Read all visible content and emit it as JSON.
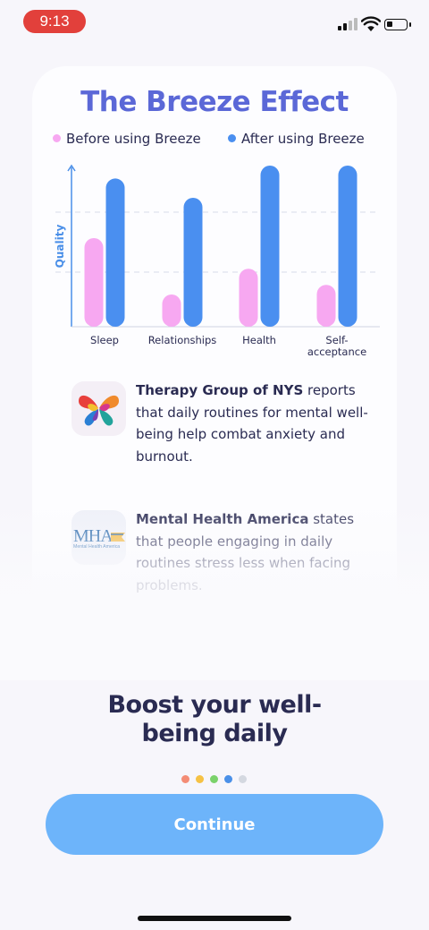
{
  "status_bar": {
    "time": "9:13"
  },
  "card": {
    "title": "The Breeze Effect",
    "legend": {
      "before": "Before using Breeze",
      "after": "After using Breeze"
    }
  },
  "chart_data": {
    "type": "bar",
    "title": "The Breeze Effect",
    "ylabel": "Quality",
    "categories": [
      "Sleep",
      "Relationships",
      "Health",
      "Self-acceptance"
    ],
    "category_lines": [
      [
        "Sleep"
      ],
      [
        "Relationships"
      ],
      [
        "Health"
      ],
      [
        "Self-",
        "acceptance"
      ]
    ],
    "series": [
      {
        "name": "Before using Breeze",
        "color": "#f7a8f1",
        "values": [
          0.55,
          0.2,
          0.36,
          0.26
        ]
      },
      {
        "name": "After using Breeze",
        "color": "#4a8ff0",
        "values": [
          0.92,
          0.8,
          1.0,
          1.0
        ]
      }
    ],
    "ylim": [
      0,
      1
    ],
    "grid": true,
    "legend_position": "top"
  },
  "sources": [
    {
      "org": "Therapy Group of NYS",
      "text": " reports that daily routines for mental well-being help combat anxiety and burnout.",
      "icon": "butterfly-logo-icon"
    },
    {
      "org": "Mental Health America",
      "text": " states that people engaging in daily routines stress less when facing problems.",
      "icon": "mha-logo-icon",
      "logo_text": "MHA",
      "logo_sub": "Mental Health America"
    }
  ],
  "headline": "Boost your well-being daily",
  "pagination": {
    "total": 5,
    "current": 4,
    "colors": [
      "#f48c75",
      "#f6c244",
      "#7bd26b",
      "#4a90e8",
      "#d4d8e0"
    ]
  },
  "continue_button": {
    "label": "Continue",
    "color": "#6db4fa"
  }
}
